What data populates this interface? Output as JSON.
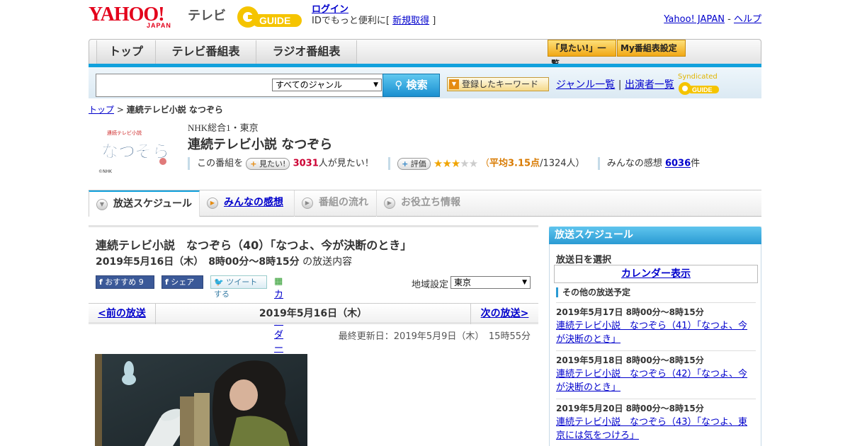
{
  "header": {
    "yahoo_logo_text": "YAHOO!",
    "yahoo_japan_text": "JAPAN",
    "tv_label": "テレビ",
    "gguide_text": "GUIDE",
    "login_label": "ログイン",
    "login_sub_prefix": "IDでもっと便利に[",
    "signup_label": "新規取得",
    "login_sub_suffix": "]",
    "yahoo_japan_link": "Yahoo! JAPAN",
    "help_separator": "-",
    "help_link": "ヘルプ"
  },
  "nav": {
    "tabs": [
      {
        "label": "トップ"
      },
      {
        "label": "テレビ番組表"
      },
      {
        "label": "ラジオ番組表"
      }
    ],
    "mitai_list_label": "「見たい!」一覧",
    "my_bangumi_label": "My番組表設定"
  },
  "search": {
    "genre_selected": "すべてのジャンル",
    "search_button": "検索",
    "keyword_button": "登録したキーワード",
    "genre_list_link": "ジャンル一覧",
    "divider": "|",
    "performer_list_link": "出演者一覧",
    "syndicated_label": "Syndicated"
  },
  "breadcrumb": {
    "home": "トップ",
    "separator": ">",
    "current": "連続テレビ小説 なつぞら"
  },
  "program": {
    "logo_title": "連続テレビ小説",
    "logo_text": "なつぞら",
    "logo_credit": "©NHK",
    "channel": "NHK総合1・東京",
    "title": "連続テレビ小説 なつぞら",
    "mitai_prefix": "この番組を",
    "mitai_button": "見たい!",
    "mitai_count": "3031",
    "mitai_suffix": "人が見たい！",
    "rating_button": "評価",
    "rating_value": 3.15,
    "rating_open": "（",
    "avg_label": "平均3.15点",
    "rating_count": "/1324人）",
    "kansou_prefix": "みんなの感想",
    "kansou_count": "6036",
    "kansou_suffix": "件"
  },
  "subtabs": [
    {
      "label": "放送スケジュール"
    },
    {
      "label": "みんなの感想"
    },
    {
      "label": "番組の流れ"
    },
    {
      "label": "お役立ち情報"
    }
  ],
  "episode": {
    "title": "連続テレビ小説　なつぞら（40）「なつよ、今が決断のとき」",
    "date_time": "2019年5月16日（木）　8時00分～8時15分",
    "date_suffix": "の放送内容",
    "fb_recommend": "おすすめ",
    "fb_count": "9",
    "fb_share": "シェア",
    "tweet": "ツイートする",
    "calendar_link": "カレンダーに登録",
    "region_label": "地域設定",
    "region_value": "東京",
    "prev_link": "<前の放送",
    "current_date": "2019年5月16日（木）",
    "next_link": "次の放送>",
    "updated": "最終更新日：2019年5月9日（木）　15時55分"
  },
  "sidebar": {
    "header": "放送スケジュール",
    "select_day": "放送日を選択",
    "calendar_link": "カレンダー表示",
    "other_label": "その他の放送予定",
    "items": [
      {
        "date": "2019年5月17日  8時00分～8時15分",
        "title": "連続テレビ小説　なつぞら（41）「なつよ、今が決断のとき」"
      },
      {
        "date": "2019年5月18日  8時00分～8時15分",
        "title": "連続テレビ小説　なつぞら（42）「なつよ、今が決断のとき」"
      },
      {
        "date": "2019年5月20日  8時00分～8時15分",
        "title": "連続テレビ小説　なつぞら（43）「なつよ、東京には気をつけろ」"
      }
    ]
  },
  "colors": {
    "accent_blue": "#12a1dc",
    "yahoo_red": "#e3001b",
    "gold": "#f1a816",
    "link": "#0000cc"
  },
  "icons": [
    "search-icon",
    "dropdown-arrow-icon",
    "plus-icon",
    "star-icon",
    "facebook-icon",
    "twitter-icon",
    "calendar-icon",
    "play-circle-icon",
    "gguide-logo"
  ]
}
